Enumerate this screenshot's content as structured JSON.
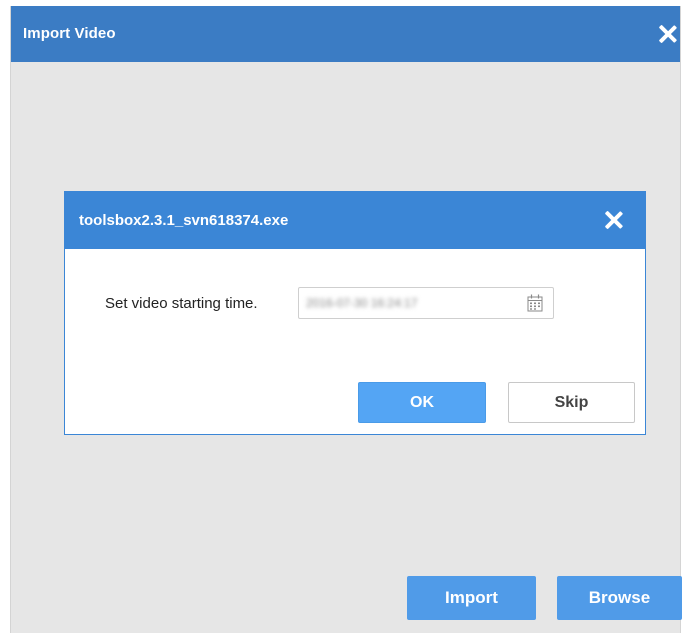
{
  "outer_window": {
    "title": "Import Video",
    "close_icon": "close-icon",
    "buttons": {
      "import_label": "Import",
      "browse_label": "Browse"
    }
  },
  "dialog": {
    "title": "toolsbox2.3.1_svn618374.exe",
    "close_icon": "close-icon",
    "field_label": "Set video starting time.",
    "date_value": "2016-07-30 16:24:17",
    "calendar_icon": "calendar-icon",
    "ok_label": "OK",
    "skip_label": "Skip"
  },
  "colors": {
    "titlebar": "#3b7cc4",
    "dialog_titlebar": "#3b86d6",
    "primary_button": "#509be8",
    "background": "#e6e6e6"
  }
}
